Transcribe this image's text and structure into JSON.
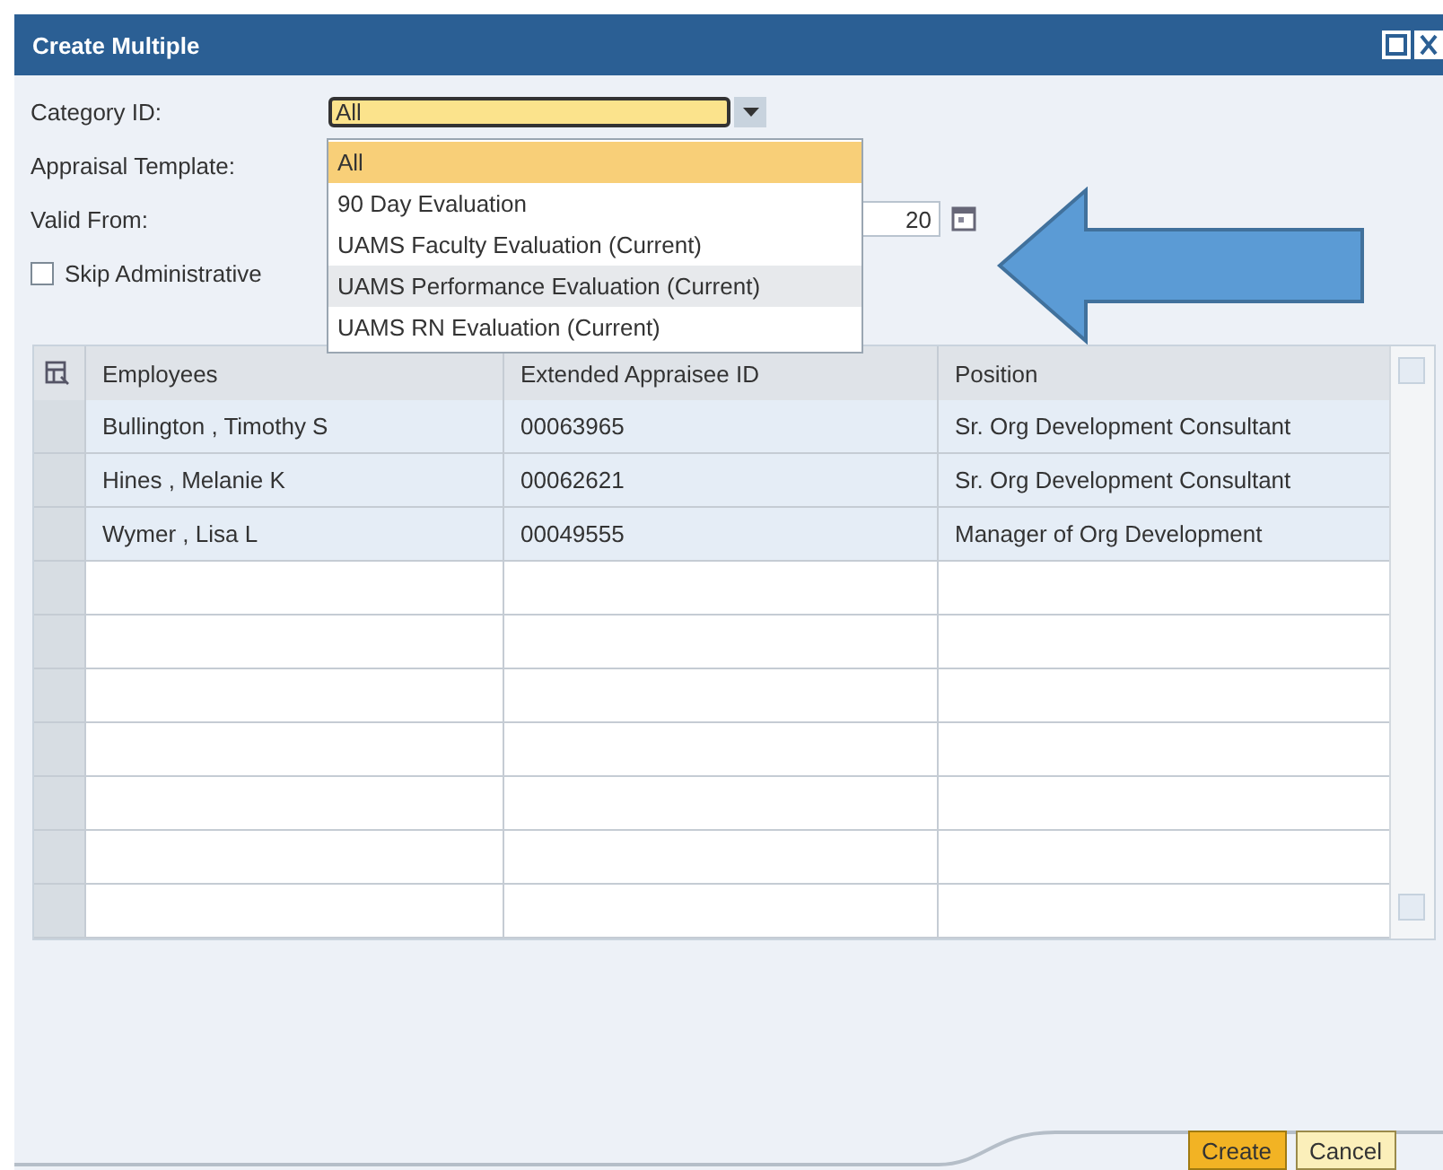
{
  "window": {
    "title": "Create Multiple"
  },
  "fields": [
    {
      "kind": "dropdown",
      "label": "Category ID:",
      "value": "All"
    },
    {
      "kind": "hidden",
      "label": "Appraisal Template:"
    },
    {
      "kind": "date",
      "label": "Valid From:",
      "value": "20"
    },
    {
      "kind": "checkbox",
      "label": "Skip Administrative",
      "checked": false
    }
  ],
  "dropdown_options": [
    {
      "label": "All",
      "selected": true,
      "highlighted": false
    },
    {
      "label": "90 Day Evaluation",
      "selected": false,
      "highlighted": false
    },
    {
      "label": "UAMS Faculty Evaluation (Current)",
      "selected": false,
      "highlighted": false
    },
    {
      "label": "UAMS Performance Evaluation (Current)",
      "selected": false,
      "highlighted": true
    },
    {
      "label": "UAMS RN Evaluation (Current)",
      "selected": false,
      "highlighted": false
    }
  ],
  "table": {
    "columns": [
      "Employees",
      "Extended Appraisee ID",
      "Position"
    ],
    "rows": [
      [
        "Bullington , Timothy S",
        "00063965",
        "Sr. Org Development Consultant"
      ],
      [
        "Hines , Melanie K",
        "00062621",
        "Sr. Org Development Consultant"
      ],
      [
        "Wymer , Lisa L",
        "00049555",
        "Manager of Org Development"
      ]
    ]
  },
  "buttons": [
    {
      "label": "Create",
      "primary": true
    },
    {
      "label": "Cancel",
      "primary": false
    }
  ]
}
